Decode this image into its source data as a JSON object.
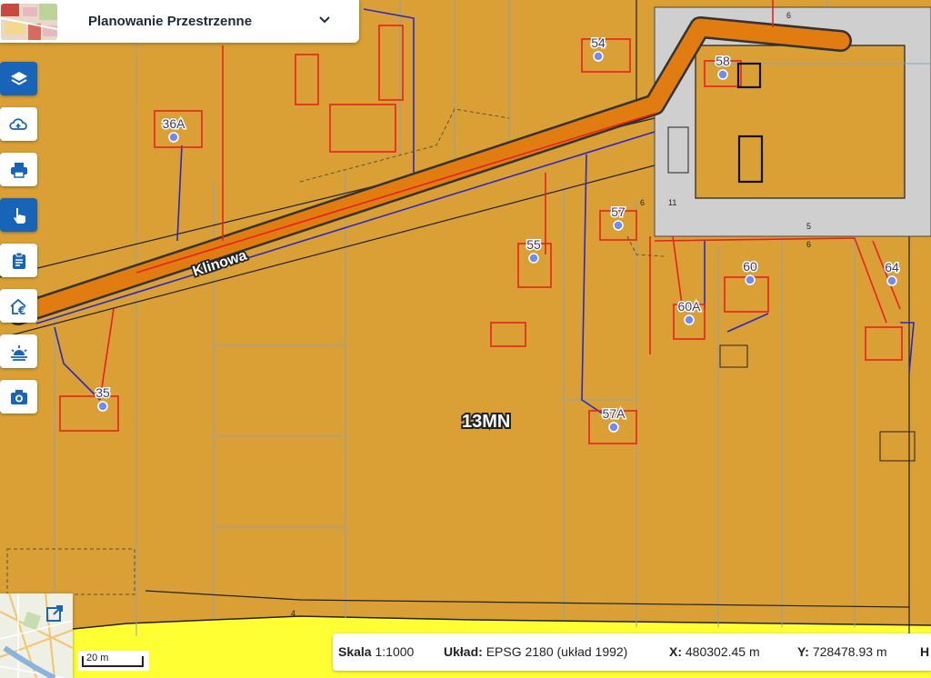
{
  "header": {
    "title": "Planowanie Przestrzenne",
    "dropdown_icon": "chevron-down-icon"
  },
  "toolbar": [
    {
      "name": "layers",
      "icon": "layers-icon",
      "active": true
    },
    {
      "name": "cloud-add",
      "icon": "cloud-add-icon",
      "active": false
    },
    {
      "name": "print",
      "icon": "print-icon",
      "active": false
    },
    {
      "name": "identify",
      "icon": "hand-pointer-icon",
      "active": true
    },
    {
      "name": "report",
      "icon": "clipboard-icon",
      "active": false
    },
    {
      "name": "property-price",
      "icon": "house-euro-icon",
      "active": false
    },
    {
      "name": "sunrise",
      "icon": "sunrise-icon",
      "active": false
    },
    {
      "name": "screenshot",
      "icon": "camera-icon",
      "active": false
    }
  ],
  "map": {
    "street_name": "Klinowa",
    "zone_label": "13MN",
    "addresses": [
      "36A",
      "54",
      "58",
      "57",
      "55",
      "60",
      "64",
      "60A",
      "35",
      "57A"
    ],
    "small_labels": [
      "6",
      "11",
      "6",
      "5",
      "6",
      "4"
    ],
    "colors": {
      "zone_fill": "#daa036",
      "road": "#e07c10",
      "red_lines": "#e82020",
      "blue_lines": "#2828c8",
      "yellow_area": "#ffff33"
    }
  },
  "minimap": {
    "expand_icon": "external-link-icon"
  },
  "scalebar": {
    "label": "20 m"
  },
  "statusbar": {
    "scale_label": "Skala",
    "scale_value": "1:1000",
    "crs_label": "Układ:",
    "crs_value": "EPSG 2180 (układ 1992)",
    "x_label": "X:",
    "x_value": "480302.45 m",
    "y_label": "Y:",
    "y_value": "728478.93 m",
    "h_label": "H"
  }
}
